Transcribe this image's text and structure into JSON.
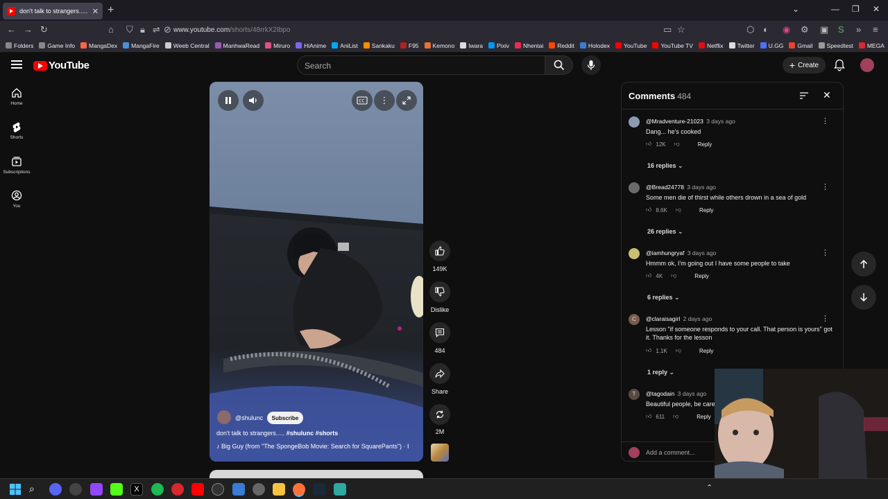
{
  "browser": {
    "tab_title": "don't talk to strangers..... #",
    "url_host": "www.youtube.com",
    "url_path": "/shorts/48rrkX2Ibpo",
    "bookmarks": [
      {
        "label": "Folders",
        "color": "#888888"
      },
      {
        "label": "Game Info",
        "color": "#888888"
      },
      {
        "label": "MangaDex",
        "color": "#ff6740"
      },
      {
        "label": "MangaFire",
        "color": "#4a8fd6"
      },
      {
        "label": "Weeb Central",
        "color": "#cccccc"
      },
      {
        "label": "ManhwaRead",
        "color": "#9b59b6"
      },
      {
        "label": "Miruro",
        "color": "#e05080"
      },
      {
        "label": "HiAnime",
        "color": "#7b68ee"
      },
      {
        "label": "AniList",
        "color": "#02a9ff"
      },
      {
        "label": "Sankaku",
        "color": "#ff8c00"
      },
      {
        "label": "F95",
        "color": "#b22222"
      },
      {
        "label": "Kemono",
        "color": "#e87030"
      },
      {
        "label": "Iwara",
        "color": "#dddddd"
      },
      {
        "label": "Pixiv",
        "color": "#0096fa"
      },
      {
        "label": "Nhentai",
        "color": "#ec2854"
      },
      {
        "label": "Reddit",
        "color": "#ff4500"
      },
      {
        "label": "Holodex",
        "color": "#3a7bd5"
      },
      {
        "label": "YouTube",
        "color": "#ff0000"
      },
      {
        "label": "YouTube TV",
        "color": "#ff0000"
      },
      {
        "label": "Netflix",
        "color": "#e50914"
      },
      {
        "label": "Twitter",
        "color": "#dddddd"
      },
      {
        "label": "U.GG",
        "color": "#4c70ff"
      },
      {
        "label": "Gmail",
        "color": "#ea4335"
      },
      {
        "label": "Speedtest",
        "color": "#999999"
      },
      {
        "label": "MEGA",
        "color": "#d9272e"
      }
    ]
  },
  "header": {
    "logo_text": "YouTube",
    "search_placeholder": "Search",
    "create_label": "Create"
  },
  "sidebar": {
    "items": [
      {
        "label": "Home",
        "icon": "home-icon"
      },
      {
        "label": "Shorts",
        "icon": "shorts-icon"
      },
      {
        "label": "Subscriptions",
        "icon": "subscriptions-icon"
      },
      {
        "label": "You",
        "icon": "you-icon"
      }
    ]
  },
  "video": {
    "channel": "@shulunc",
    "subscribe_label": "Subscribe",
    "title": "don't talk to strangers..... ",
    "hashtags": "#shulunc #shorts",
    "music": "Big Guy (from \"The SpongeBob Movie: Search for SquarePants\") · I"
  },
  "actions": {
    "likes": "149K",
    "dislike_label": "Dislike",
    "comments": "484",
    "share_label": "Share",
    "remix": "2M"
  },
  "comments": {
    "title": "Comments",
    "count": "484",
    "add_placeholder": "Add a comment...",
    "items": [
      {
        "author": "@Mradventure-21023",
        "time": "3 days ago",
        "text": "Dang... he's cooked",
        "likes": "12K",
        "replies": "16 replies",
        "avatar_color": "#8a9bb0"
      },
      {
        "author": "@Bread24778",
        "time": "3 days ago",
        "text": "Some men die of thirst while others drown in a sea of gold",
        "likes": "8.6K",
        "replies": "26 replies",
        "avatar_color": "#6a6a6a"
      },
      {
        "author": "@iamhungryaf",
        "time": "3 days ago",
        "text": "Hmmm ok, I'm going out I have some people to take",
        "likes": "4K",
        "replies": "6 replies",
        "avatar_color": "#c8c070"
      },
      {
        "author": "@claraisagirl",
        "time": "2 days ago",
        "text": "Lesson \"if someone responds to your call. That person is yours\" got it. Thanks for the lesson",
        "likes": "1.1K",
        "replies": "1 reply",
        "avatar_color": "#7a5a50",
        "initial": "C"
      },
      {
        "author": "@tagodain",
        "time": "3 days ago",
        "text": "Beautiful people, be care",
        "likes": "611",
        "replies": "",
        "avatar_color": "#5a4a44",
        "initial": "T"
      }
    ],
    "reply_label": "Reply"
  }
}
